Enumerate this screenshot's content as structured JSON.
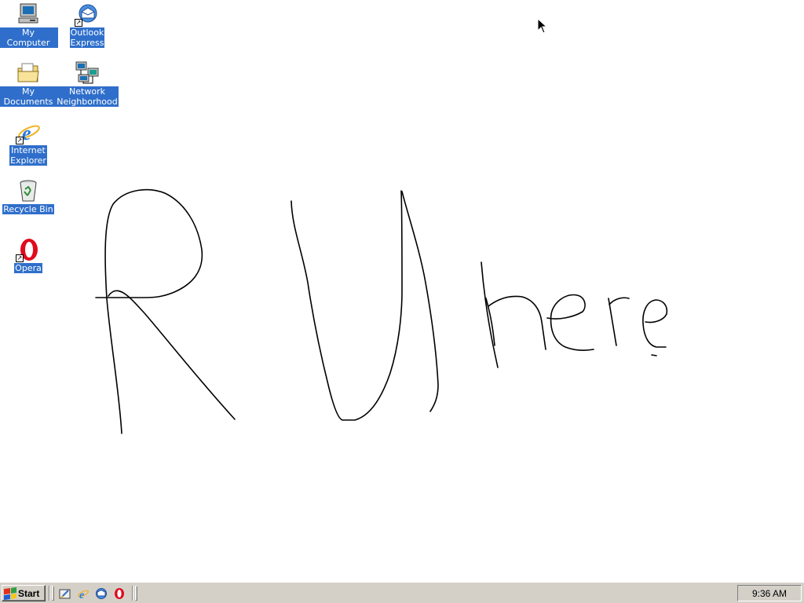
{
  "desktop": {
    "icons": [
      {
        "label": "My Computer",
        "icon": "my-computer-icon",
        "shortcut": false
      },
      {
        "label": "Outlook\nExpress",
        "icon": "outlook-express-icon",
        "shortcut": true
      },
      {
        "label": "My Documents",
        "icon": "my-documents-icon",
        "shortcut": false
      },
      {
        "label": "Network\nNeighborhood",
        "icon": "network-neighborhood-icon",
        "shortcut": false
      },
      {
        "label": "Internet\nExplorer",
        "icon": "internet-explorer-icon",
        "shortcut": true
      },
      {
        "label": "Recycle Bin",
        "icon": "recycle-bin-icon",
        "shortcut": false
      },
      {
        "label": "Opera",
        "icon": "opera-icon",
        "shortcut": true
      }
    ],
    "background_color": "#ffffff",
    "label_highlight_color": "#2f6fcb",
    "drawing": {
      "stroke_color": "#000000"
    }
  },
  "taskbar": {
    "start_label": "Start",
    "quick_launch": [
      {
        "icon": "show-desktop-icon"
      },
      {
        "icon": "internet-explorer-icon"
      },
      {
        "icon": "outlook-express-icon"
      },
      {
        "icon": "opera-icon"
      }
    ],
    "clock": "9:36 AM",
    "background_color": "#d4d0c8"
  }
}
